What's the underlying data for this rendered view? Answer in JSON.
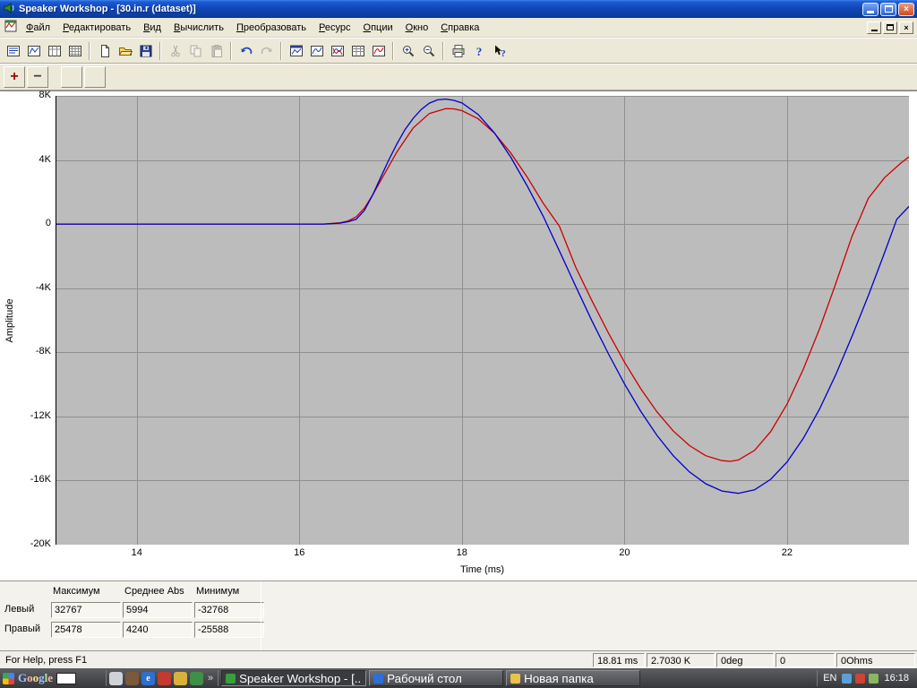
{
  "window": {
    "title": "Speaker Workshop - [30.in.r (dataset)]"
  },
  "menu": {
    "items": [
      "Файл",
      "Редактировать",
      "Вид",
      "Вычислить",
      "Преобразовать",
      "Ресурс",
      "Опции",
      "Окно",
      "Справка"
    ]
  },
  "toolbar": {
    "buttons": [
      {
        "name": "notes-view-button",
        "icon": "view-lines"
      },
      {
        "name": "chart-view-button",
        "icon": "view-chart"
      },
      {
        "name": "table-view-button",
        "icon": "view-table"
      },
      {
        "name": "grid-view-button",
        "icon": "view-grid"
      },
      {
        "sep": true
      },
      {
        "name": "new-button",
        "icon": "new-doc"
      },
      {
        "name": "open-button",
        "icon": "open-folder"
      },
      {
        "name": "save-button",
        "icon": "save"
      },
      {
        "sep": true
      },
      {
        "name": "cut-button",
        "icon": "cut",
        "disabled": true
      },
      {
        "name": "copy-button",
        "icon": "copy",
        "disabled": true
      },
      {
        "name": "paste-button",
        "icon": "paste",
        "disabled": true
      },
      {
        "sep": true
      },
      {
        "name": "undo-button",
        "icon": "undo"
      },
      {
        "name": "redo-button",
        "icon": "redo",
        "disabled": true
      },
      {
        "sep": true
      },
      {
        "name": "new-chart-window-button",
        "icon": "chart-window"
      },
      {
        "name": "chart-blue-button",
        "icon": "chart-blue"
      },
      {
        "name": "chart-overlay-button",
        "icon": "chart-overlay"
      },
      {
        "name": "data-sheet-button",
        "icon": "data-grid"
      },
      {
        "name": "chart-red-button",
        "icon": "chart-red"
      },
      {
        "sep": true
      },
      {
        "name": "zoom-in-button",
        "icon": "zoom-in"
      },
      {
        "name": "zoom-out-button",
        "icon": "zoom-out"
      },
      {
        "sep": true
      },
      {
        "name": "print-button",
        "icon": "print"
      },
      {
        "name": "help-button",
        "icon": "help"
      },
      {
        "name": "context-help-button",
        "icon": "context-help"
      }
    ]
  },
  "toolbar2": {
    "buttons": [
      {
        "name": "add-dataset-button",
        "glyph": "+",
        "color": "#b00000"
      },
      {
        "name": "remove-dataset-button",
        "glyph": "−",
        "color": "#3c3c3c"
      },
      {
        "name": "blank-button-1",
        "glyph": "",
        "disabled": true,
        "gap_before": true
      },
      {
        "name": "blank-button-2",
        "glyph": "",
        "disabled": true
      }
    ]
  },
  "chart_data": {
    "type": "line",
    "title": "",
    "xlabel": "Time (ms)",
    "ylabel": "Amplitude",
    "xlim": [
      13,
      23.5
    ],
    "ylim": [
      -20000,
      8000
    ],
    "grid": true,
    "legend": "none",
    "x_ticks": [
      {
        "value": 14,
        "label": "14"
      },
      {
        "value": 16,
        "label": "16"
      },
      {
        "value": 18,
        "label": "18"
      },
      {
        "value": 20,
        "label": "20"
      },
      {
        "value": 22,
        "label": "22"
      }
    ],
    "y_ticks": [
      {
        "value": 8000,
        "label": "8K"
      },
      {
        "value": 4000,
        "label": "4K"
      },
      {
        "value": 0,
        "label": "0"
      },
      {
        "value": -4000,
        "label": "-4K"
      },
      {
        "value": -8000,
        "label": "-8K"
      },
      {
        "value": -12000,
        "label": "-12K"
      },
      {
        "value": -16000,
        "label": "-16K"
      },
      {
        "value": -20000,
        "label": "-20K"
      }
    ],
    "series": [
      {
        "name": "right-channel",
        "color": "#cc0000",
        "x": [
          13,
          14,
          15,
          16,
          16.3,
          16.5,
          16.6,
          16.7,
          16.8,
          16.9,
          17.0,
          17.2,
          17.4,
          17.6,
          17.8,
          17.9,
          18.0,
          18.2,
          18.4,
          18.6,
          18.8,
          19.0,
          19.2,
          19.4,
          19.6,
          19.8,
          20.0,
          20.2,
          20.4,
          20.6,
          20.8,
          21.0,
          21.2,
          21.3,
          21.4,
          21.6,
          21.8,
          22.0,
          22.2,
          22.4,
          22.6,
          22.8,
          22.9,
          23.0,
          23.2,
          23.4,
          23.5
        ],
        "y": [
          0,
          0,
          0,
          0,
          0,
          80,
          200,
          450,
          1000,
          1800,
          2700,
          4500,
          6000,
          6900,
          7200,
          7190,
          7080,
          6570,
          5670,
          4440,
          2960,
          1300,
          -130,
          -2690,
          -4780,
          -6770,
          -8610,
          -10270,
          -11710,
          -12910,
          -13820,
          -14450,
          -14760,
          -14800,
          -14720,
          -14120,
          -12940,
          -11230,
          -9060,
          -6530,
          -3710,
          -750,
          400,
          1600,
          2900,
          3800,
          4200
        ]
      },
      {
        "name": "left-channel",
        "color": "#0000cc",
        "x": [
          13,
          14,
          15,
          16,
          16.3,
          16.5,
          16.6,
          16.7,
          16.8,
          16.9,
          17.0,
          17.1,
          17.2,
          17.3,
          17.4,
          17.5,
          17.6,
          17.7,
          17.8,
          17.9,
          18.0,
          18.2,
          18.4,
          18.6,
          18.8,
          19.0,
          19.2,
          19.4,
          19.6,
          19.8,
          20.0,
          20.2,
          20.4,
          20.6,
          20.8,
          21.0,
          21.2,
          21.4,
          21.6,
          21.8,
          22.0,
          22.2,
          22.4,
          22.6,
          22.8,
          23.0,
          23.2,
          23.35,
          23.5
        ],
        "y": [
          0,
          0,
          0,
          0,
          0,
          60,
          150,
          300,
          850,
          1800,
          2900,
          4000,
          5000,
          5900,
          6600,
          7150,
          7550,
          7750,
          7800,
          7720,
          7560,
          6840,
          5690,
          4180,
          2410,
          490,
          -1680,
          -3890,
          -6040,
          -8070,
          -9960,
          -11680,
          -13180,
          -14450,
          -15460,
          -16200,
          -16650,
          -16800,
          -16580,
          -15920,
          -14840,
          -13370,
          -11540,
          -9390,
          -6990,
          -4470,
          -1780,
          300,
          1100
        ]
      }
    ]
  },
  "stats": {
    "headers": [
      "Максимум",
      "Среднее Abs",
      "Минимум"
    ],
    "rows": [
      {
        "label": "Левый",
        "values": [
          "32767",
          "5994",
          "-32768"
        ]
      },
      {
        "label": "Правый",
        "values": [
          "25478",
          "4240",
          "-25588"
        ]
      }
    ]
  },
  "statusbar": {
    "help": "For Help, press F1",
    "fields": [
      "18.81  ms",
      "2.7030 K",
      "0deg",
      "0",
      "0Ohms"
    ]
  },
  "taskbar": {
    "google": {
      "logo": "Google"
    },
    "quick_launch": [
      {
        "name": "quick-launch-document-icon",
        "color": "#cfd3d8",
        "glyph": ""
      },
      {
        "name": "quick-launch-gauge-icon",
        "color": "#7a5a3a",
        "glyph": ""
      },
      {
        "name": "quick-launch-ie-icon",
        "color": "#2f6fce",
        "glyph": "e"
      },
      {
        "name": "quick-launch-player-icon",
        "color": "#c23b2e",
        "glyph": ""
      },
      {
        "name": "quick-launch-keys-icon",
        "color": "#d8b23c",
        "glyph": ""
      },
      {
        "name": "quick-launch-security-icon",
        "color": "#3f8f46",
        "glyph": ""
      }
    ],
    "overflow_chevron": "»",
    "buttons": [
      {
        "name": "task-speaker-workshop",
        "label": "Speaker Workshop - [...",
        "icon_color": "#35a03c",
        "active": true
      },
      {
        "name": "task-desktop",
        "label": "Рабочий стол",
        "icon_color": "#2d6fd8",
        "active": false
      },
      {
        "name": "task-new-folder",
        "label": "Новая папка",
        "icon_color": "#e8c24a",
        "active": false
      }
    ],
    "tray": {
      "lang": "EN",
      "icons": [
        {
          "name": "tray-display-icon",
          "color": "#5aa0d8"
        },
        {
          "name": "tray-antivirus-icon",
          "color": "#cc4433"
        },
        {
          "name": "tray-volume-icon",
          "color": "#88b860"
        }
      ],
      "time": "16:18"
    }
  }
}
